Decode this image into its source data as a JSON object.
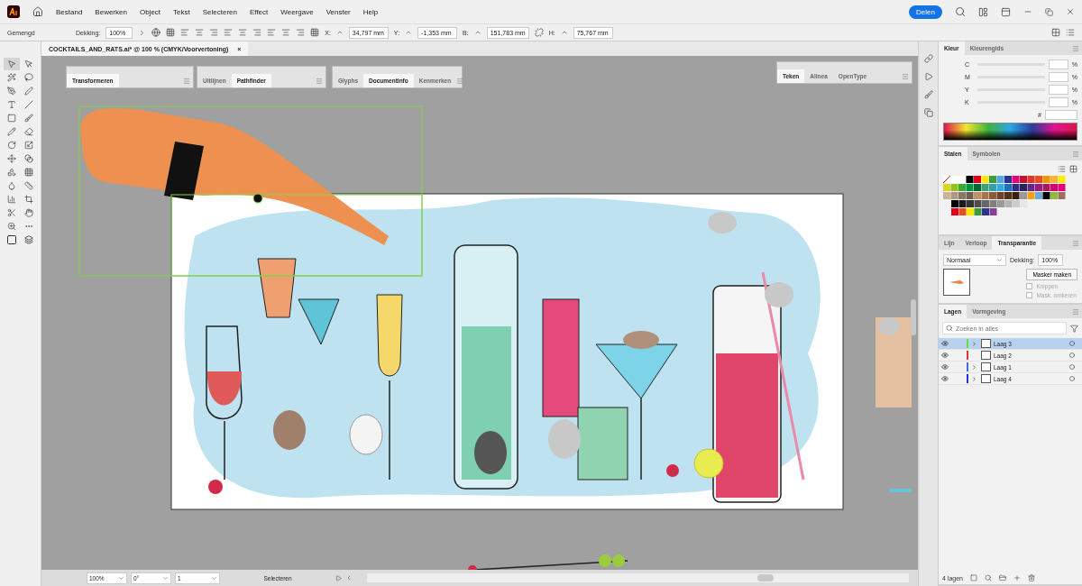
{
  "menu": {
    "items": [
      "Bestand",
      "Bewerken",
      "Object",
      "Tekst",
      "Selecteren",
      "Effect",
      "Weergave",
      "Venster",
      "Help"
    ],
    "share": "Delen"
  },
  "control_bar": {
    "mode": "Gemengd",
    "opacity_label": "Dekking:",
    "opacity": "100%",
    "fields": [
      {
        "label": "X:",
        "value": "34,797 mm"
      },
      {
        "label": "Y:",
        "value": "-1,353 mm"
      },
      {
        "label": "B:",
        "value": "151,783 mm"
      },
      {
        "label": "H:",
        "value": "75,767 mm"
      }
    ]
  },
  "document_tab": {
    "title": "COCKTAILS_AND_RATS.ai* @ 100 % (CMYK/Voorvertoning)",
    "close": "×"
  },
  "floating_panels": [
    {
      "tabs": [
        {
          "label": "Transformeren",
          "selected": true
        }
      ]
    },
    {
      "tabs": [
        {
          "label": "Uitlijnen",
          "selected": false
        },
        {
          "label": "Pathfinder",
          "selected": true
        }
      ]
    },
    {
      "tabs": [
        {
          "label": "Glyphs",
          "selected": false
        },
        {
          "label": "Documentinfo",
          "selected": true
        },
        {
          "label": "Kenmerken",
          "selected": false
        }
      ]
    },
    {
      "tabs": [
        {
          "label": "Teken",
          "selected": true
        },
        {
          "label": "Alinea",
          "selected": false
        },
        {
          "label": "OpenType",
          "selected": false
        }
      ]
    }
  ],
  "color_panel": {
    "tabs": [
      {
        "label": "Kleur",
        "selected": true
      },
      {
        "label": "Kleurengids",
        "selected": false
      }
    ],
    "channels": [
      {
        "label": "C",
        "level": 0
      },
      {
        "label": "M",
        "level": 0
      },
      {
        "label": "Y",
        "level": 0
      },
      {
        "label": "K",
        "level": 0
      }
    ],
    "unit": "%",
    "hex_label": "#"
  },
  "swatches_panel": {
    "tabs": [
      {
        "label": "Stalen",
        "selected": true
      },
      {
        "label": "Symbolen",
        "selected": false
      }
    ]
  },
  "transparency_panel": {
    "tabs": [
      {
        "label": "Lijn",
        "selected": false
      },
      {
        "label": "Verloop",
        "selected": false
      },
      {
        "label": "Transparantie",
        "selected": true
      }
    ],
    "blend_mode": "Normaal",
    "opacity_label": "Dekking:",
    "opacity": "100%",
    "mask_button": "Masker maken",
    "options": [
      {
        "label": "Knippen",
        "checked": false,
        "disabled": true
      },
      {
        "label": "Mask. omkeren",
        "checked": false,
        "disabled": true
      }
    ]
  },
  "layers_panel": {
    "tabs": [
      {
        "label": "Lagen",
        "selected": true
      },
      {
        "label": "Vormgeving",
        "selected": false
      }
    ],
    "search_placeholder": "Zoeken in alles",
    "items": [
      {
        "name": "Laag 3",
        "color": "#5fe03a",
        "selected": true,
        "visible": true,
        "expandable": true
      },
      {
        "name": "Laag 2",
        "color": "#e0342c",
        "selected": false,
        "visible": true,
        "expandable": false
      },
      {
        "name": "Laag 1",
        "color": "#3a6fe8",
        "selected": false,
        "visible": true,
        "expandable": true
      },
      {
        "name": "Laag 4",
        "color": "#2c2ce0",
        "selected": false,
        "visible": true,
        "expandable": true
      }
    ],
    "count": "4 lagen"
  },
  "status_bar": {
    "zoom": "100%",
    "rotation": "0°",
    "artboard": "1",
    "tool": "Selecteren"
  }
}
